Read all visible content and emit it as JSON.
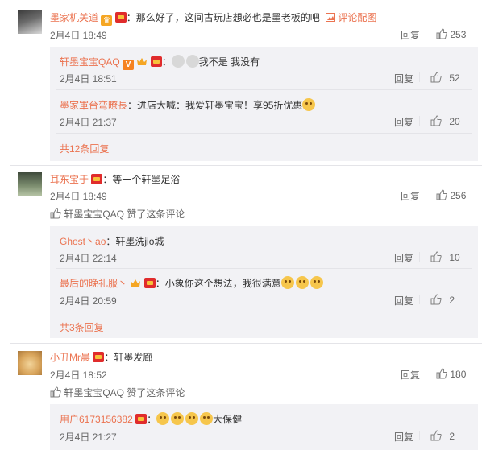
{
  "comments": [
    {
      "author": "墨家机关道",
      "text": "：那么好了，这间古玩店想必也是墨老板的吧",
      "extra_link": "评论配图",
      "date": "2月4日 18:49",
      "reply_label": "回复",
      "likes": "253",
      "replies": [
        {
          "author": "轩墨宝宝QAQ",
          "text": "我不是 我没有",
          "date": "2月4日 18:51",
          "reply_label": "回复",
          "likes": "52"
        },
        {
          "author": "墨家軍台弯暸長",
          "text": "：进店大喊：我爱轩墨宝宝！享95折优惠",
          "date": "2月4日 21:37",
          "reply_label": "回复",
          "likes": "20"
        }
      ],
      "more": "共12条回复"
    },
    {
      "author": "耳东宝于",
      "text": "：等一个轩墨足浴",
      "date": "2月4日 18:49",
      "reply_label": "回复",
      "likes": "256",
      "liked_by_name": "轩墨宝宝QAQ",
      "liked_by_suffix": " 赞了这条评论",
      "replies": [
        {
          "author": "Ghost丶ao",
          "text": "：轩墨洗jio城",
          "date": "2月4日 22:14",
          "reply_label": "回复",
          "likes": "10"
        },
        {
          "author": "最后的晚礼服丶",
          "text": "：小象你这个想法，我很满意",
          "date": "2月4日 20:59",
          "reply_label": "回复",
          "likes": "2"
        }
      ],
      "more": "共3条回复"
    },
    {
      "author": "小丑Mr晨",
      "text": "：轩墨发廊",
      "date": "2月4日 18:52",
      "reply_label": "回复",
      "likes": "180",
      "liked_by_name": "轩墨宝宝QAQ",
      "liked_by_suffix": " 赞了这条评论",
      "replies": [
        {
          "author": "用户6173156382",
          "text": "大保健",
          "date": "2月4日 21:27",
          "reply_label": "回复",
          "likes": "2"
        }
      ]
    }
  ],
  "icons": {
    "thumb": "thumbs-up-icon",
    "vip": "vip-badge-icon",
    "red": "red-envelope-badge-icon",
    "crown": "crown-badge-icon",
    "emoji": "cat-emoji-icon",
    "image": "image-icon"
  },
  "colors": {
    "author": "#eb7350",
    "text": "#333333",
    "meta": "#666666",
    "reply_bg": "#f2f2f5"
  }
}
